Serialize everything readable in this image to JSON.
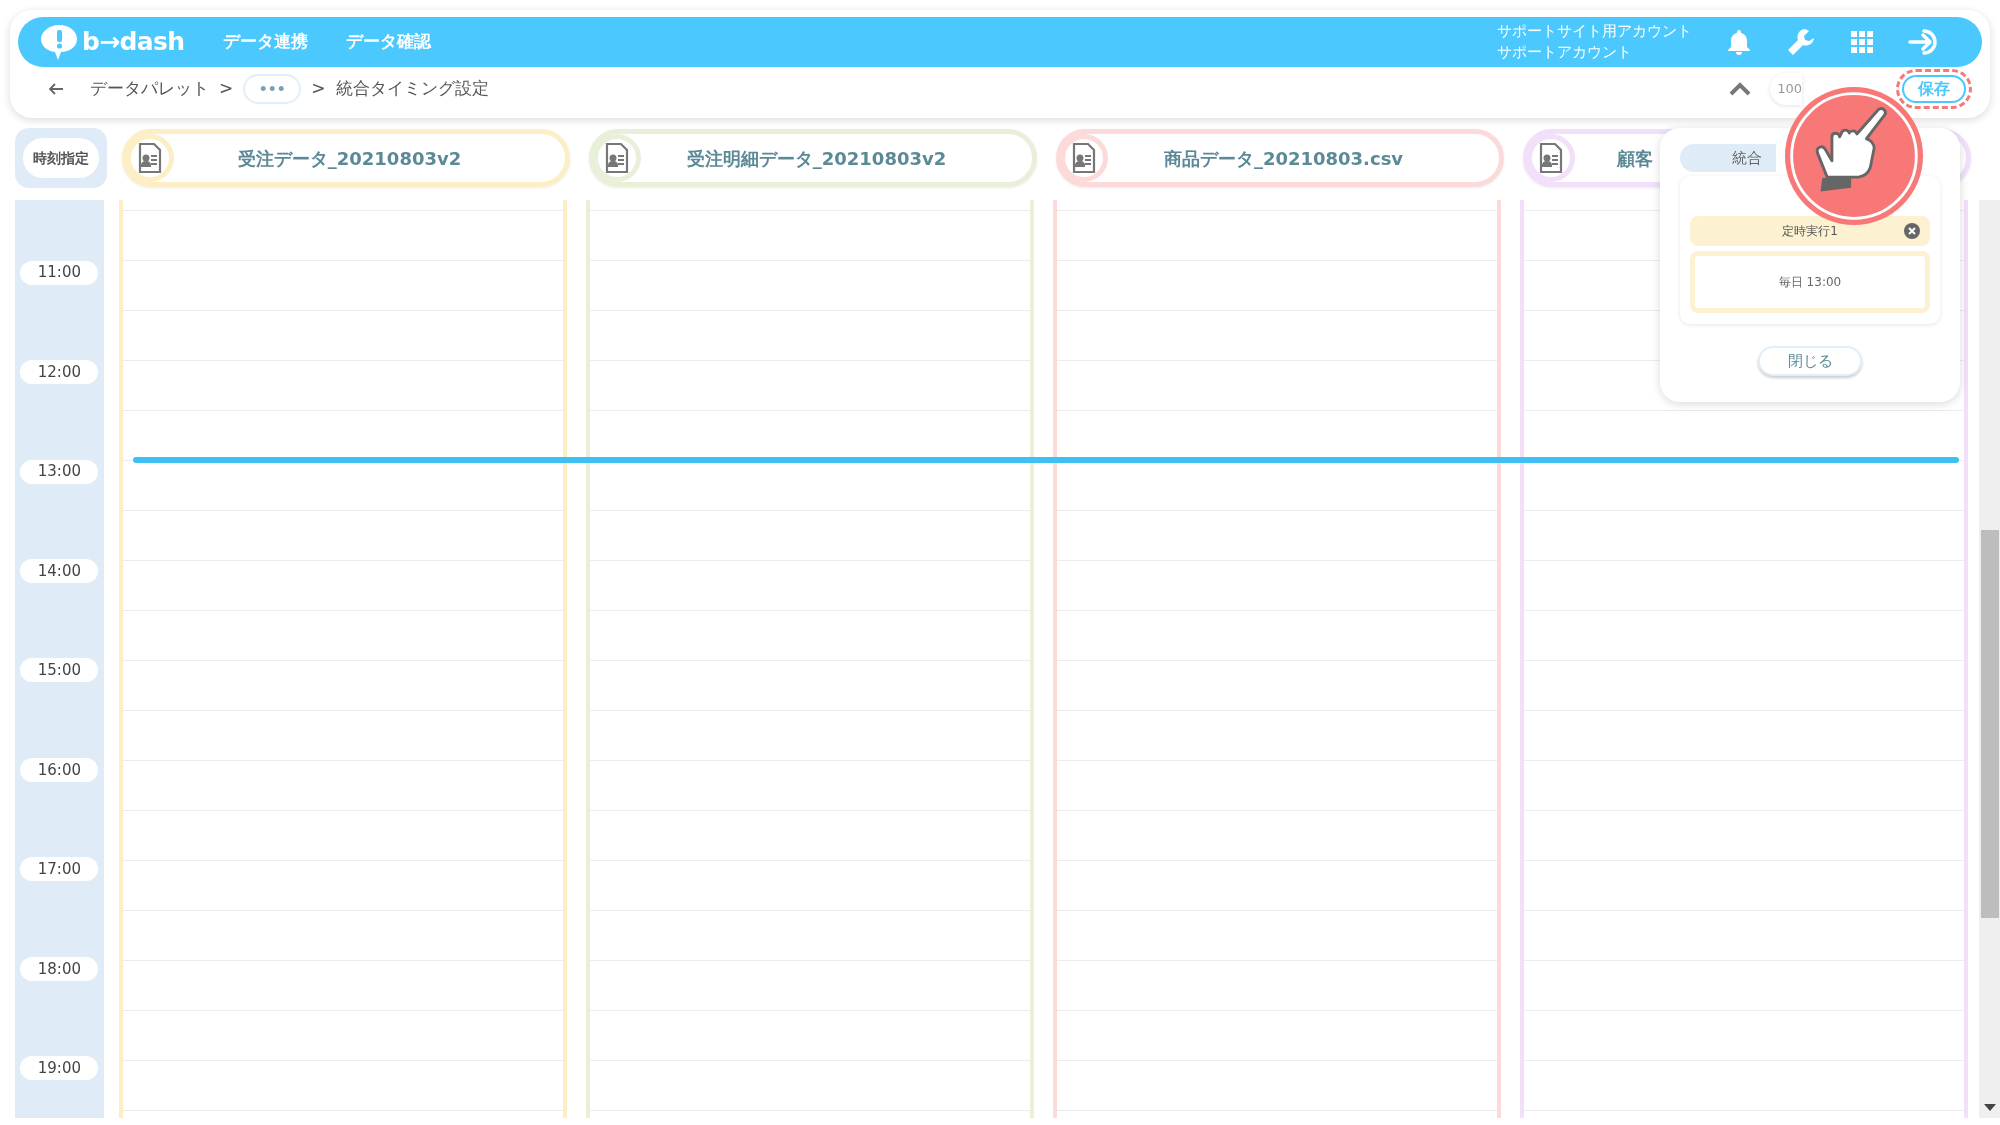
{
  "header": {
    "logo": "b→dash",
    "nav": [
      {
        "label": "データ連携"
      },
      {
        "label": "データ確認"
      }
    ],
    "account": [
      "サポートサイト用アカウント",
      "サポートアカウント"
    ]
  },
  "breadcrumb": [
    {
      "kind": "link",
      "label": "データパレット"
    },
    {
      "kind": "separator",
      "label": ">"
    },
    {
      "kind": "more",
      "label": "•••"
    },
    {
      "kind": "separator",
      "label": ">"
    },
    {
      "kind": "current",
      "label": "統合タイミング設定"
    }
  ],
  "zoom_level": "100",
  "save_button": "保存",
  "time_header": "時刻指定",
  "columns": [
    {
      "name": "受注データ_20210803v2",
      "color": "#fcefc6",
      "kind": "full"
    },
    {
      "name": "受注明細データ_20210803v2",
      "color": "#e9f0da",
      "kind": "full"
    },
    {
      "name": "商品データ_20210803.csv",
      "color": "#fcdada",
      "kind": "full"
    },
    {
      "name": "顧客",
      "color": "#f2e0fa",
      "kind": "partial"
    }
  ],
  "hours": [
    "11:00",
    "12:00",
    "13:00",
    "14:00",
    "15:00",
    "16:00",
    "17:00",
    "18:00",
    "19:00"
  ],
  "popup": {
    "tab": "統合",
    "entry": {
      "label": "定時実行1",
      "schedule": "毎日 13:00"
    },
    "close_button": "閉じる"
  }
}
